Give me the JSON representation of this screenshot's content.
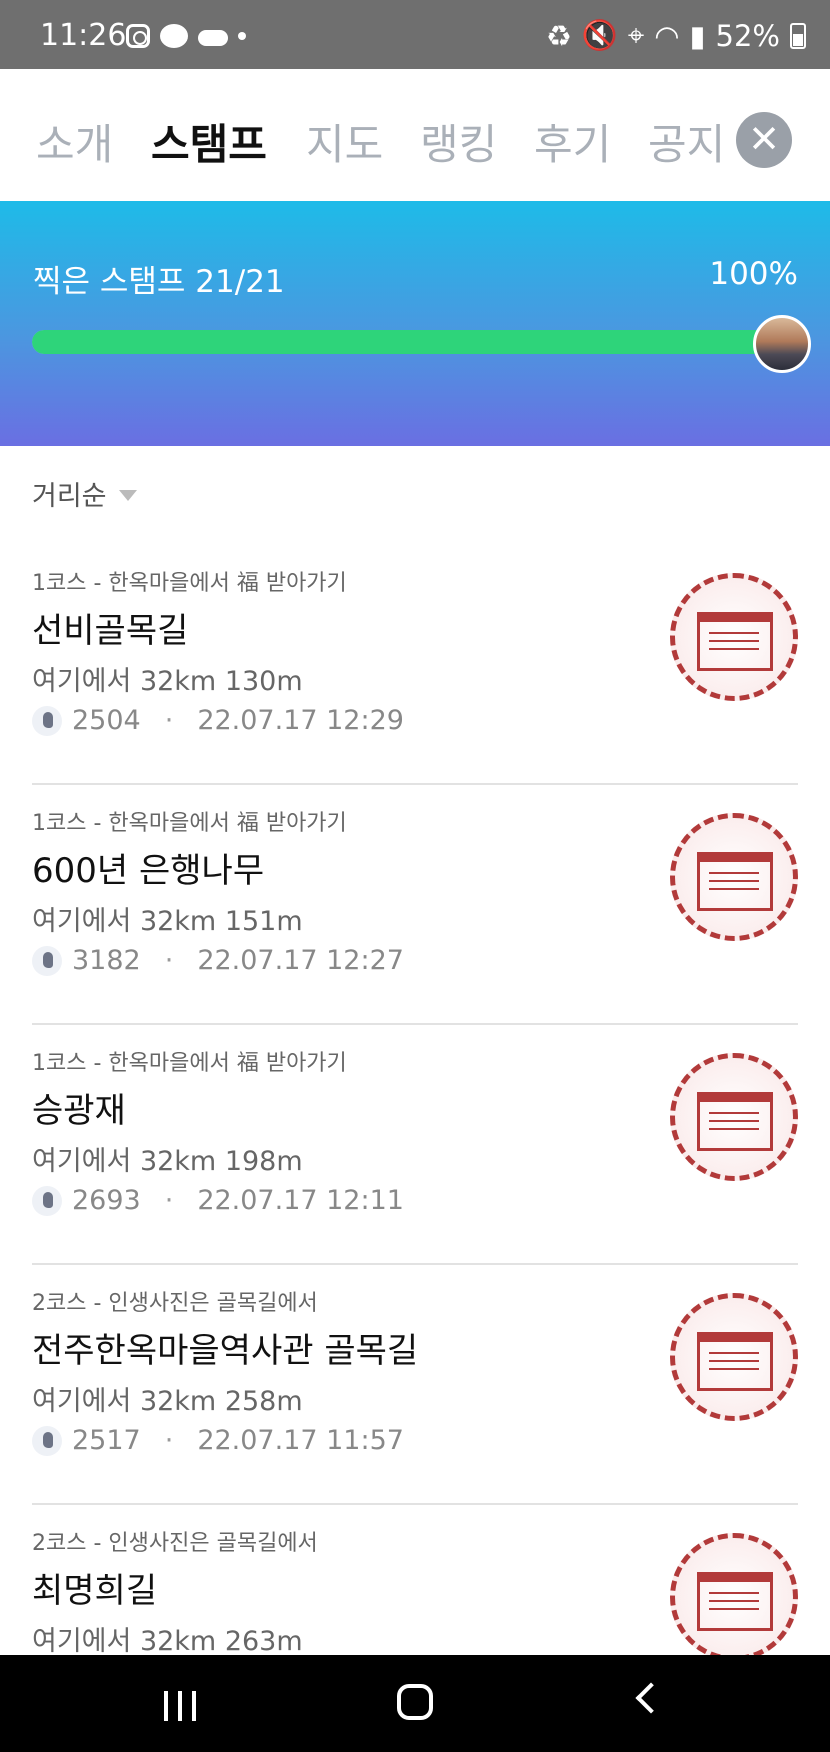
{
  "status_bar": {
    "time": "11:26",
    "battery": "52%",
    "left_icons": [
      "instagram-icon",
      "chat-bubble-icon",
      "cloud-icon",
      "dot-icon"
    ],
    "right_icons": [
      "battery-saver-icon",
      "mute-icon",
      "location-icon",
      "wifi-icon",
      "signal-icon"
    ]
  },
  "tabs": [
    {
      "label": "소개",
      "active": false
    },
    {
      "label": "스탬프",
      "active": true
    },
    {
      "label": "지도",
      "active": false
    },
    {
      "label": "랭킹",
      "active": false
    },
    {
      "label": "후기",
      "active": false
    },
    {
      "label": "공지",
      "active": false
    }
  ],
  "progress": {
    "label": "찍은 스탬프 21/21",
    "percent_text": "100%",
    "fraction": 1.0,
    "fill_color": "#2ed47a"
  },
  "sort": {
    "label": "거리순"
  },
  "stamps": [
    {
      "course": "1코스 - 한옥마을에서 福 받아가기",
      "name": "선비골목길",
      "distance": "여기에서 32km 130m",
      "count": "2504",
      "datetime": "22.07.17 12:29"
    },
    {
      "course": "1코스 - 한옥마을에서 福 받아가기",
      "name": "600년 은행나무",
      "distance": "여기에서 32km 151m",
      "count": "3182",
      "datetime": "22.07.17 12:27"
    },
    {
      "course": "1코스 - 한옥마을에서 福 받아가기",
      "name": "승광재",
      "distance": "여기에서 32km 198m",
      "count": "2693",
      "datetime": "22.07.17 12:11"
    },
    {
      "course": "2코스 - 인생사진은 골목길에서",
      "name": "전주한옥마을역사관 골목길",
      "distance": "여기에서 32km 258m",
      "count": "2517",
      "datetime": "22.07.17 11:57"
    },
    {
      "course": "2코스 - 인생사진은 골목길에서",
      "name": "최명희길",
      "distance": "여기에서 32km 263m",
      "count": "",
      "datetime": ""
    }
  ],
  "colors": {
    "banner_top": "#1ebbe8",
    "banner_bottom": "#6a6fe2",
    "stamp_red": "#b23a3a"
  }
}
